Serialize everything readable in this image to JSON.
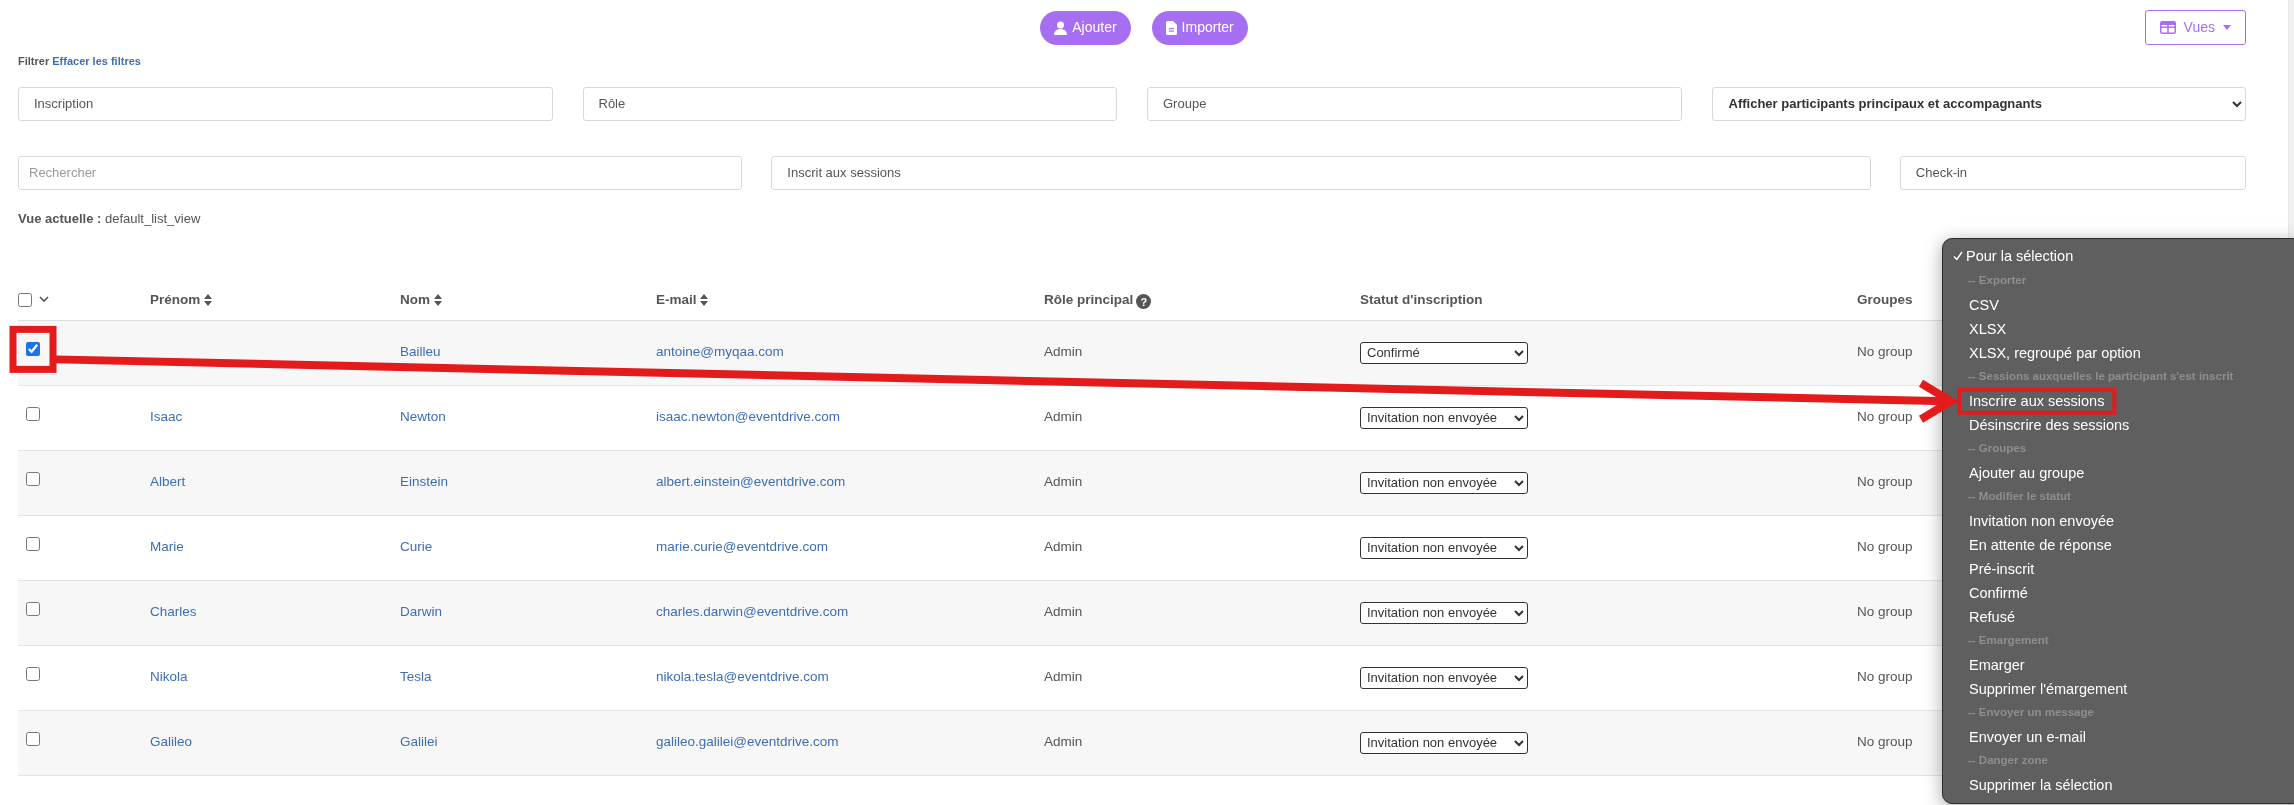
{
  "toolbar": {
    "buttons": [
      {
        "label": "Ajouter"
      },
      {
        "label": "Importer"
      }
    ],
    "views_button": {
      "label": "Vues"
    }
  },
  "filter_bar": {
    "label": "Filtrer",
    "clear_link": "Effacer les filtres"
  },
  "filter_rows": [
    [
      {
        "kind": "multiselect",
        "placeholder": "Inscription"
      },
      {
        "kind": "multiselect",
        "placeholder": "Rôle"
      },
      {
        "kind": "multiselect",
        "placeholder": "Groupe"
      },
      {
        "kind": "select",
        "value": "Afficher participants principaux et accompagnants"
      }
    ],
    [
      {
        "kind": "search",
        "placeholder": "Rechercher"
      },
      {
        "kind": "multiselect",
        "placeholder": "Inscrit aux sessions"
      },
      {
        "kind": "multiselect",
        "placeholder": "Check-in"
      }
    ]
  ],
  "current_view": {
    "label": "Vue actuelle :",
    "value": "default_list_view"
  },
  "table": {
    "select_all_checked": false,
    "columns": [
      {
        "label": "Prénom",
        "sortable": true
      },
      {
        "label": "Nom",
        "sortable": true
      },
      {
        "label": "E-mail",
        "sortable": true
      },
      {
        "label": "Rôle principal",
        "sortable": false,
        "help": "?"
      },
      {
        "label": "Statut d'inscription",
        "sortable": false
      },
      {
        "label": "Groupes",
        "sortable": false
      }
    ],
    "rows": [
      {
        "selected": true,
        "annotated": true,
        "last_name": "Bailleu",
        "email": "antoine@myqaa.com",
        "role": "Admin",
        "status": "Confirmé",
        "groups": "No group"
      },
      {
        "selected": false,
        "first_name": "Isaac",
        "last_name": "Newton",
        "email": "isaac.newton@eventdrive.com",
        "role": "Admin",
        "status": "Invitation non envoyée",
        "groups": "No group"
      },
      {
        "selected": false,
        "first_name": "Albert",
        "last_name": "Einstein",
        "email": "albert.einstein@eventdrive.com",
        "role": "Admin",
        "status": "Invitation non envoyée",
        "groups": "No group"
      },
      {
        "selected": false,
        "first_name": "Marie",
        "last_name": "Curie",
        "email": "marie.curie@eventdrive.com",
        "role": "Admin",
        "status": "Invitation non envoyée",
        "groups": "No group"
      },
      {
        "selected": false,
        "first_name": "Charles",
        "last_name": "Darwin",
        "email": "charles.darwin@eventdrive.com",
        "role": "Admin",
        "status": "Invitation non envoyée",
        "groups": "No group"
      },
      {
        "selected": false,
        "first_name": "Nikola",
        "last_name": "Tesla",
        "email": "nikola.tesla@eventdrive.com",
        "role": "Admin",
        "status": "Invitation non envoyée",
        "groups": "No group"
      },
      {
        "selected": false,
        "first_name": "Galileo",
        "last_name": "Galilei",
        "email": "galileo.galilei@eventdrive.com",
        "role": "Admin",
        "status": "Invitation non envoyée",
        "groups": "No group"
      }
    ]
  },
  "selection_menu": {
    "title": "Pour la sélection",
    "checked": true,
    "items": [
      {
        "kind": "header",
        "label": "-- Exporter"
      },
      {
        "kind": "item",
        "label": "CSV"
      },
      {
        "kind": "item",
        "label": "XLSX"
      },
      {
        "kind": "item",
        "label": "XLSX, regroupé par option"
      },
      {
        "kind": "header",
        "label": "-- Sessions auxquelles le participant s'est inscrit"
      },
      {
        "kind": "item",
        "label": "Inscrire aux sessions",
        "annotated": true
      },
      {
        "kind": "item",
        "label": "Désinscrire des sessions"
      },
      {
        "kind": "header",
        "label": "-- Groupes"
      },
      {
        "kind": "item",
        "label": "Ajouter au groupe"
      },
      {
        "kind": "header",
        "label": "-- Modifier le statut"
      },
      {
        "kind": "item",
        "label": "Invitation non envoyée"
      },
      {
        "kind": "item",
        "label": "En attente de réponse"
      },
      {
        "kind": "item",
        "label": "Pré-inscrit"
      },
      {
        "kind": "item",
        "label": "Confirmé"
      },
      {
        "kind": "item",
        "label": "Refusé"
      },
      {
        "kind": "header",
        "label": "-- Emargement"
      },
      {
        "kind": "item",
        "label": "Emarger"
      },
      {
        "kind": "item",
        "label": "Supprimer l'émargement"
      },
      {
        "kind": "header",
        "label": "-- Envoyer un message"
      },
      {
        "kind": "item",
        "label": "Envoyer un e-mail"
      },
      {
        "kind": "header",
        "label": "-- Danger zone"
      },
      {
        "kind": "item",
        "label": "Supprimer la sélection"
      }
    ]
  }
}
